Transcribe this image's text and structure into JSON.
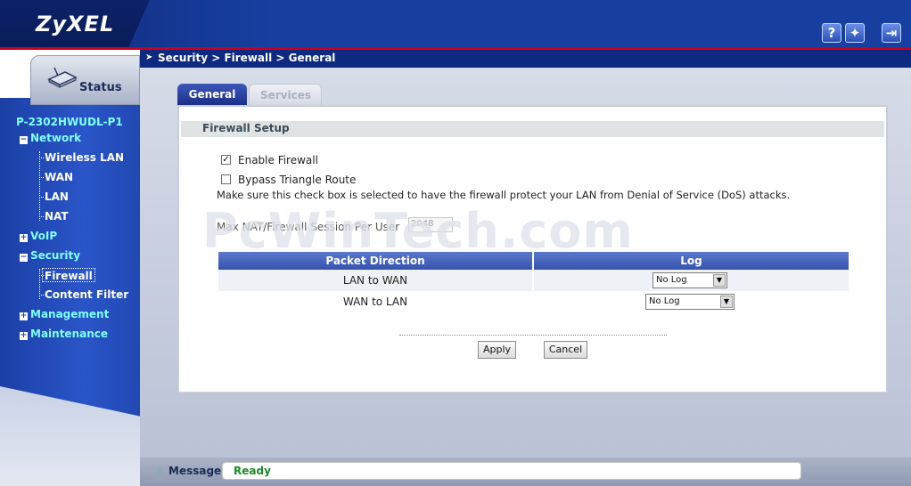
{
  "header": {
    "logo": "ZyXEL",
    "icons": [
      "help-icon",
      "wizard-icon",
      "logout-icon"
    ]
  },
  "sidebar": {
    "status_label": "Status",
    "device_name": "P-2302HWUDL-P1",
    "items": [
      {
        "label": "Network",
        "expander": "−"
      },
      {
        "label": "Wireless LAN"
      },
      {
        "label": "WAN"
      },
      {
        "label": "LAN"
      },
      {
        "label": "NAT"
      },
      {
        "label": "VoIP",
        "expander": "+"
      },
      {
        "label": "Security",
        "expander": "−"
      },
      {
        "label": "Firewall"
      },
      {
        "label": "Content Filter"
      },
      {
        "label": "Management",
        "expander": "+"
      },
      {
        "label": "Maintenance",
        "expander": "+"
      }
    ]
  },
  "breadcrumb": "Security > Firewall > General",
  "tabs": [
    {
      "label": "General",
      "active": true
    },
    {
      "label": "Services",
      "active": false
    }
  ],
  "section_title": "Firewall Setup",
  "form": {
    "enable_firewall": {
      "label": "Enable Firewall",
      "checked": true,
      "mark": "✓"
    },
    "bypass_triangle": {
      "label": "Bypass Triangle Route",
      "checked": false
    },
    "dos_note": "Make sure this check box is selected to have the firewall protect your LAN from Denial of Service (DoS) attacks.",
    "session_label": "Max NAT/Firewall Session Per User",
    "session_value": "2048"
  },
  "table": {
    "headers": [
      "Packet Direction",
      "Log"
    ],
    "rows": [
      {
        "direction": "LAN to WAN",
        "log": "No Log"
      },
      {
        "direction": "WAN to LAN",
        "log": "No Log"
      }
    ]
  },
  "buttons": {
    "apply": "Apply",
    "cancel": "Cancel"
  },
  "watermark": "PcWinTech.com",
  "footer": {
    "label": "Message",
    "status": "Ready"
  },
  "colors": {
    "header_blue": "#173fa0",
    "accent_red": "#c8001e",
    "nav_cyan": "#7fffff",
    "status_green": "#1a8a2a"
  }
}
